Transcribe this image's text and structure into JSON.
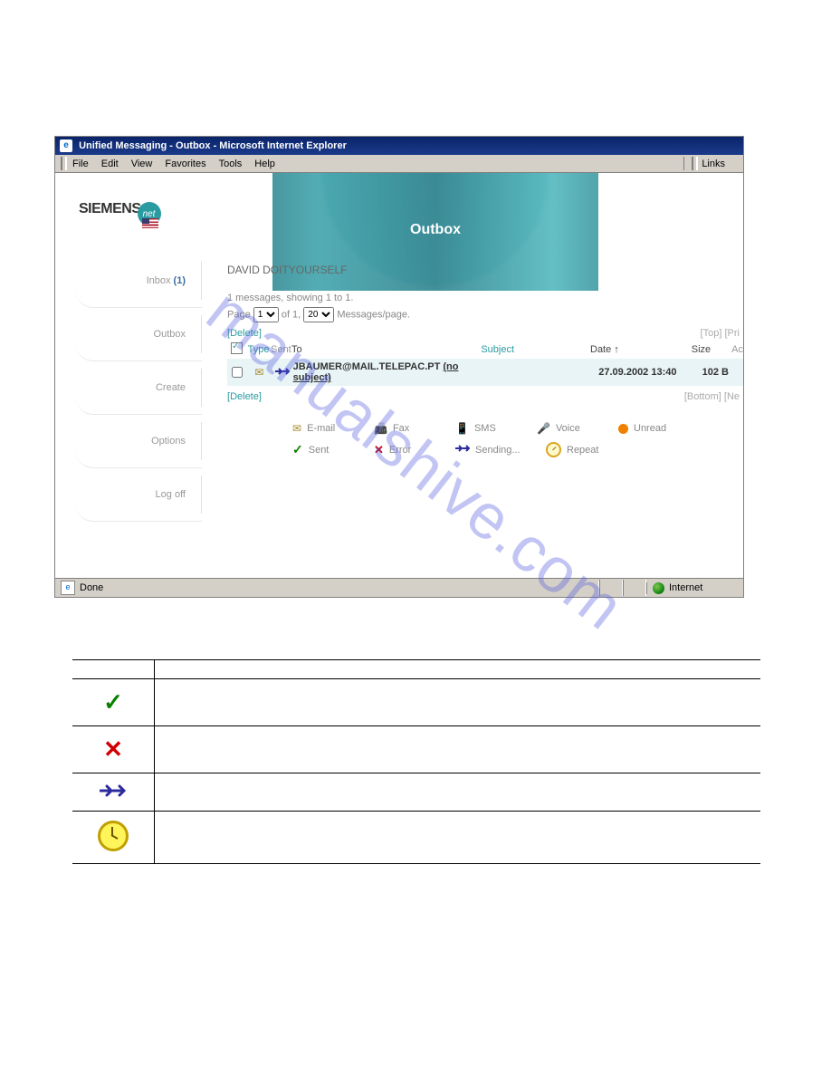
{
  "window": {
    "title": "Unified Messaging - Outbox - Microsoft Internet Explorer"
  },
  "menubar": {
    "file": "File",
    "edit": "Edit",
    "view": "View",
    "favorites": "Favorites",
    "tools": "Tools",
    "help": "Help",
    "links": "Links"
  },
  "logo": {
    "brand": "SIEMENS",
    "net": "net"
  },
  "header": {
    "title": "Outbox"
  },
  "sidebar": {
    "items": [
      {
        "label": "Inbox",
        "count": "(1)"
      },
      {
        "label": "Outbox"
      },
      {
        "label": "Create"
      },
      {
        "label": "Options"
      },
      {
        "label": "Log off"
      }
    ]
  },
  "content": {
    "username": "DAVID DOITYOURSELF",
    "messages_showing": "1 messages, showing 1 to 1.",
    "page_label": "Page",
    "page_value": "1",
    "of_label": "of 1,",
    "per_page_value": "20",
    "per_page_label": "Messages/page.",
    "delete_top": "Delete",
    "delete_bottom": "Delete",
    "top_link": "Top",
    "print_link": "Pri",
    "bottom_link": "Bottom",
    "next_link": "Ne"
  },
  "columns": {
    "type": "Type",
    "sent": "Sent",
    "to": "To",
    "subject": "Subject",
    "date": "Date ↑",
    "size": "Size",
    "ac": "Ac"
  },
  "rows": [
    {
      "to": "JBAUMER@MAIL.TELEPAC.PT",
      "subject": "(no subject)",
      "date": "27.09.2002 13:40",
      "size": "102 B"
    }
  ],
  "legend": {
    "email": "E-mail",
    "fax": "Fax",
    "sms": "SMS",
    "voice": "Voice",
    "unread": "Unread",
    "sent": "Sent",
    "error": "Error",
    "sending": "Sending...",
    "repeat": "Repeat"
  },
  "statusbar": {
    "done": "Done",
    "zone": "Internet"
  },
  "watermark": "manualshive.com"
}
